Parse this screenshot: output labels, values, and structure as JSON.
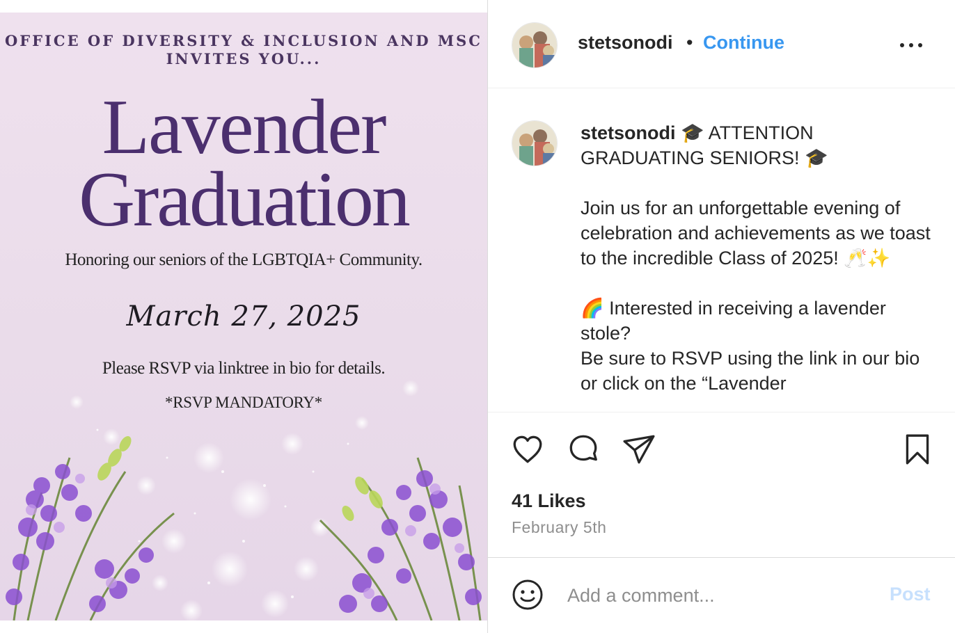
{
  "flyer": {
    "header_line1": "OFFICE OF DIVERSITY & INCLUSION AND MSC",
    "header_line2": "INVITES YOU...",
    "title_line1": "Lavender",
    "title_line2": "Graduation",
    "honoring": "Honoring our seniors of the LGBTQIA+ Community.",
    "date": "March 27, 2025",
    "rsvp": "Please RSVP via linktree in bio for details.",
    "mandatory": "*RSVP MANDATORY*"
  },
  "header": {
    "username": "stetsonodi",
    "separator": "•",
    "continue_label": "Continue"
  },
  "caption": {
    "username": "stetsonodi",
    "line1": "🎓 ATTENTION GRADUATING SENIORS! 🎓",
    "para2": "Join us for an unforgettable evening of celebration and achievements as we toast to the incredible Class of 2025! 🥂✨",
    "para3a": "🌈 Interested in receiving a lavender stole?",
    "para3b": "Be sure to RSVP using the link in our bio or click on the “Lavender"
  },
  "actions": {
    "likes": "41 Likes",
    "date": "February 5th"
  },
  "comment": {
    "placeholder": "Add a comment...",
    "post_label": "Post"
  },
  "icons": {
    "like": "heart-icon",
    "comment": "comment-bubble-icon",
    "share": "paper-plane-icon",
    "save": "bookmark-icon",
    "emoji": "smiley-icon",
    "more": "more-dots-icon"
  },
  "colors": {
    "link_blue": "#3897f0",
    "post_disabled": "#c7e0fd",
    "flyer_bg": "#ecdeeb",
    "title_purple": "#4b2f6e"
  }
}
